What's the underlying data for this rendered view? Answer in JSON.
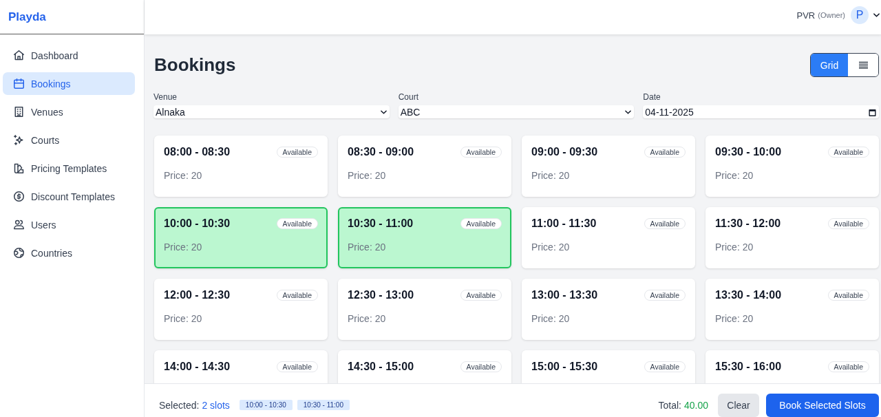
{
  "sidebar": {
    "logo": "Playda",
    "items": [
      {
        "label": "Dashboard",
        "selected": false
      },
      {
        "label": "Bookings",
        "selected": true
      },
      {
        "label": "Venues",
        "selected": false
      },
      {
        "label": "Courts",
        "selected": false
      },
      {
        "label": "Pricing Templates",
        "selected": false
      },
      {
        "label": "Discount Templates",
        "selected": false
      },
      {
        "label": "Users",
        "selected": false
      },
      {
        "label": "Countries",
        "selected": false
      }
    ]
  },
  "top_bar": {
    "user_name": "PVR",
    "user_role": "(Owner)",
    "avatar": "P"
  },
  "page": {
    "title": "Bookings",
    "view_toggle": [
      {
        "kind": "text",
        "label": "Grid",
        "selected": true
      },
      {
        "kind": "icon",
        "selected": false
      }
    ]
  },
  "filters": [
    {
      "kind": "select",
      "label": "Venue",
      "value": "Alnaka"
    },
    {
      "kind": "select",
      "label": "Court",
      "value": "ABC"
    },
    {
      "kind": "date",
      "label": "Date",
      "value": "04-11-2025"
    }
  ],
  "slots": [
    {
      "time": "08:00 - 08:30",
      "status": "Available",
      "price": "Price: 20",
      "selected": false
    },
    {
      "time": "08:30 - 09:00",
      "status": "Available",
      "price": "Price: 20",
      "selected": false
    },
    {
      "time": "09:00 - 09:30",
      "status": "Available",
      "price": "Price: 20",
      "selected": false
    },
    {
      "time": "09:30 - 10:00",
      "status": "Available",
      "price": "Price: 20",
      "selected": false
    },
    {
      "time": "10:00 - 10:30",
      "status": "Available",
      "price": "Price: 20",
      "selected": true
    },
    {
      "time": "10:30 - 11:00",
      "status": "Available",
      "price": "Price: 20",
      "selected": true
    },
    {
      "time": "11:00 - 11:30",
      "status": "Available",
      "price": "Price: 20",
      "selected": false
    },
    {
      "time": "11:30 - 12:00",
      "status": "Available",
      "price": "Price: 20",
      "selected": false
    },
    {
      "time": "12:00 - 12:30",
      "status": "Available",
      "price": "Price: 20",
      "selected": false
    },
    {
      "time": "12:30 - 13:00",
      "status": "Available",
      "price": "Price: 20",
      "selected": false
    },
    {
      "time": "13:00 - 13:30",
      "status": "Available",
      "price": "Price: 20",
      "selected": false
    },
    {
      "time": "13:30 - 14:00",
      "status": "Available",
      "price": "Price: 20",
      "selected": false
    },
    {
      "time": "14:00 - 14:30",
      "status": "Available",
      "selected": false
    },
    {
      "time": "14:30 - 15:00",
      "status": "Available",
      "selected": false
    },
    {
      "time": "15:00 - 15:30",
      "status": "Available",
      "selected": false
    },
    {
      "time": "15:30 - 16:00",
      "status": "Available",
      "selected": false
    }
  ],
  "footer": {
    "selected_label": "Selected:",
    "selected_count": "2 slots",
    "chips": [
      "10:00 - 10:30",
      "10:30 - 11:00"
    ],
    "total_label": "Total:",
    "total": "40.00",
    "buttons": [
      {
        "kind": "secondary",
        "label": "Clear"
      },
      {
        "kind": "primary",
        "label": "Book Selected Slots"
      }
    ]
  }
}
